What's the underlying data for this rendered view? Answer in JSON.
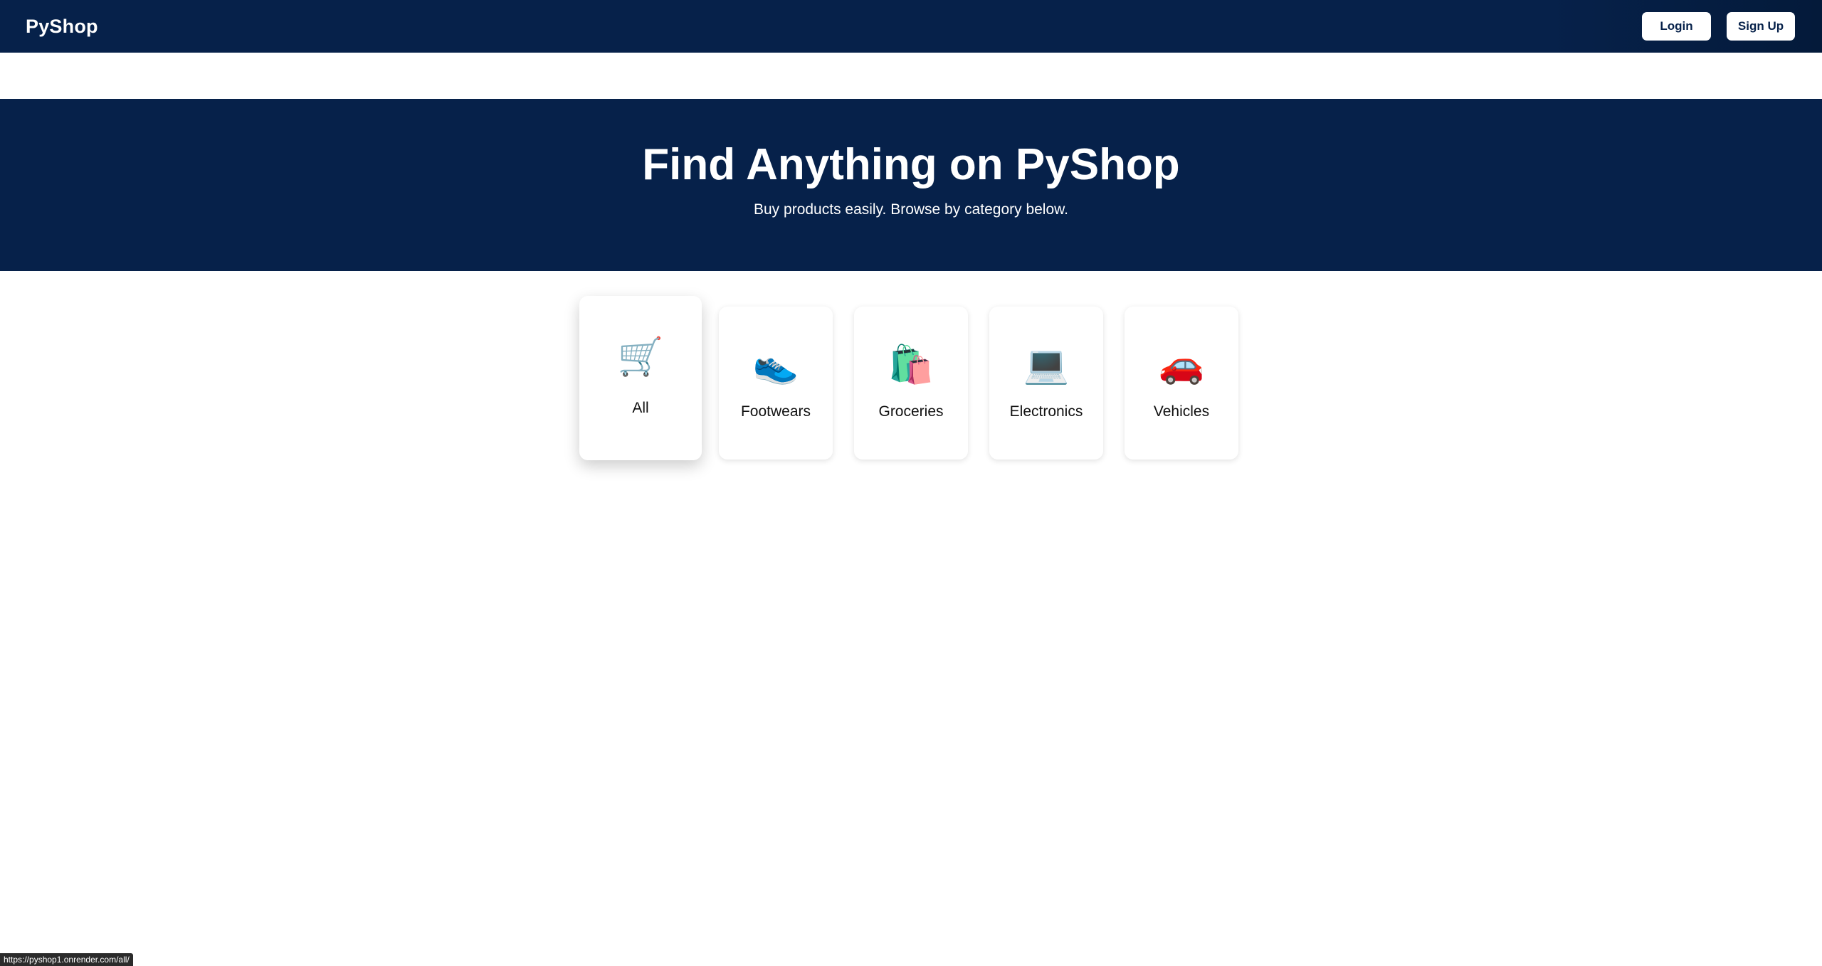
{
  "navbar": {
    "brand": "PyShop",
    "login_label": "Login",
    "signup_label": "Sign Up"
  },
  "hero": {
    "title": "Find Anything on PyShop",
    "subtitle": "Buy products easily. Browse by category below."
  },
  "categories": [
    {
      "label": "All",
      "icon": "🛒",
      "icon_name": "shopping-cart-icon",
      "active": true
    },
    {
      "label": "Footwears",
      "icon": "👟",
      "icon_name": "sneaker-icon",
      "active": false
    },
    {
      "label": "Groceries",
      "icon": "🛍️",
      "icon_name": "shopping-bags-icon",
      "active": false
    },
    {
      "label": "Electronics",
      "icon": "💻",
      "icon_name": "laptop-icon",
      "active": false
    },
    {
      "label": "Vehicles",
      "icon": "🚗",
      "icon_name": "car-icon",
      "active": false
    }
  ],
  "status_bar": {
    "url": "https://pyshop1.onrender.com/all/"
  },
  "colors": {
    "primary": "#06214a",
    "background": "#ffffff"
  }
}
